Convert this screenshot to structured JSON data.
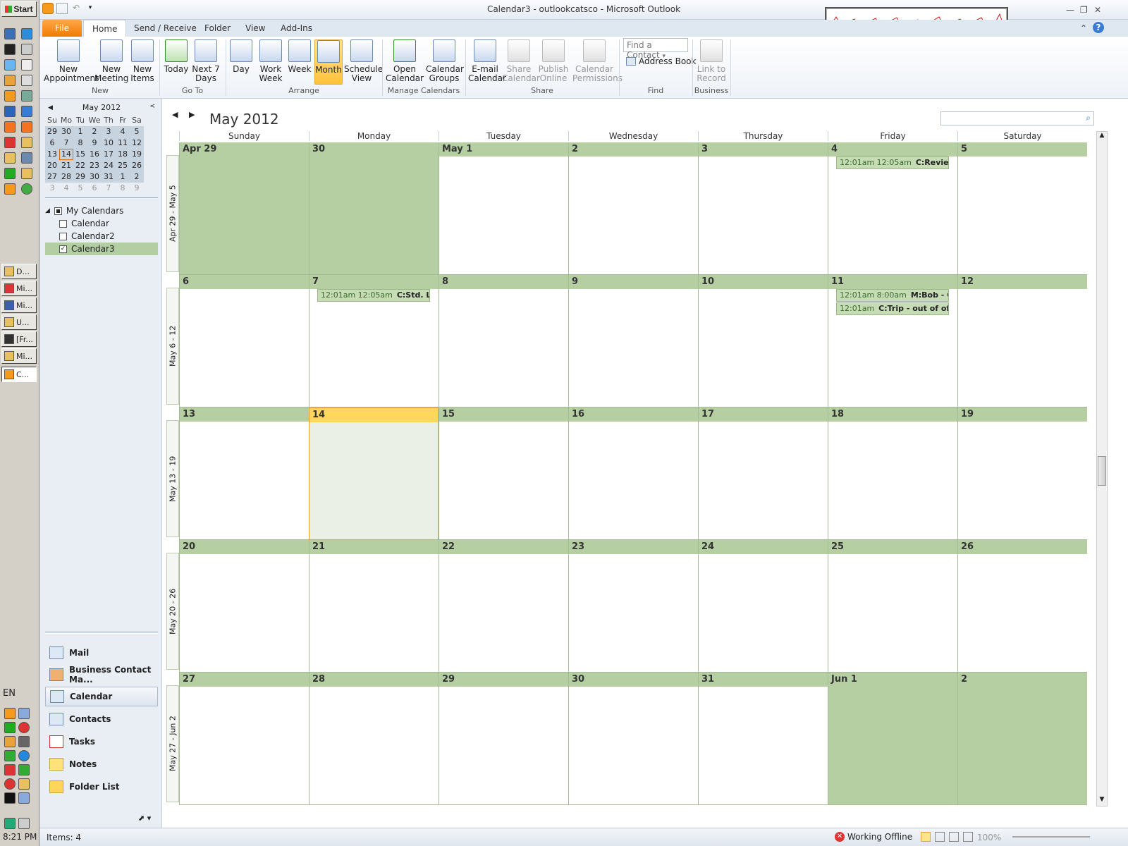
{
  "window": {
    "title": "Calendar3 - outlookcatsco  -  Microsoft Outlook"
  },
  "taskbar": {
    "start_label": "Start",
    "tasks": [
      {
        "label": "D..."
      },
      {
        "label": "Mi..."
      },
      {
        "label": "Mi..."
      },
      {
        "label": "U..."
      },
      {
        "label": "[Fr..."
      },
      {
        "label": "Mi..."
      },
      {
        "label": "C..."
      }
    ],
    "lang": "EN",
    "clock": "8:21 PM"
  },
  "tabs": [
    "File",
    "Home",
    "Send / Receive",
    "Folder",
    "View",
    "Add-Ins"
  ],
  "ribbon": {
    "new_appointment": "New\nAppointment",
    "new_meeting": "New\nMeeting",
    "new_items": "New\nItems",
    "today": "Today",
    "next7": "Next 7\nDays",
    "day": "Day",
    "work_week": "Work\nWeek",
    "week": "Week",
    "month": "Month",
    "schedule_view": "Schedule\nView",
    "open_calendar": "Open\nCalendar",
    "calendar_groups": "Calendar\nGroups",
    "email_calendar": "E-mail\nCalendar",
    "share_calendar": "Share\nCalendar",
    "publish_online": "Publish\nOnline",
    "calendar_permissions": "Calendar\nPermissions",
    "find_contact": "Find a Contact",
    "address_book": "Address Book",
    "link_to_record": "Link to\nRecord",
    "groups": {
      "new": "New",
      "goto": "Go To",
      "arrange": "Arrange",
      "manage": "Manage Calendars",
      "share": "Share",
      "find": "Find",
      "business": "Business"
    }
  },
  "minical": {
    "title": "May 2012",
    "headers": [
      "Su",
      "Mo",
      "Tu",
      "We",
      "Th",
      "Fr",
      "Sa"
    ],
    "days": [
      "29",
      "30",
      "1",
      "2",
      "3",
      "4",
      "5",
      "6",
      "7",
      "8",
      "9",
      "10",
      "11",
      "12",
      "13",
      "14",
      "15",
      "16",
      "17",
      "18",
      "19",
      "20",
      "21",
      "22",
      "23",
      "24",
      "25",
      "26",
      "27",
      "28",
      "29",
      "30",
      "31",
      "1",
      "2",
      "3",
      "4",
      "5",
      "6",
      "7",
      "8",
      "9"
    ]
  },
  "my_calendars": {
    "heading": "My Calendars",
    "items": [
      {
        "label": "Calendar",
        "checked": false
      },
      {
        "label": "Calendar2",
        "checked": false
      },
      {
        "label": "Calendar3",
        "checked": true
      }
    ]
  },
  "nav_buttons": [
    "Mail",
    "Business Contact Ma...",
    "Calendar",
    "Contacts",
    "Tasks",
    "Notes",
    "Folder List"
  ],
  "calendar": {
    "title": "May 2012",
    "days": [
      "Sunday",
      "Monday",
      "Tuesday",
      "Wednesday",
      "Thursday",
      "Friday",
      "Saturday"
    ],
    "weeks": [
      {
        "label": "Apr 29 - May 5",
        "dates": [
          "Apr 29",
          "30",
          "May 1",
          "2",
          "3",
          "4",
          "5"
        ]
      },
      {
        "label": "May 6 - 12",
        "dates": [
          "6",
          "7",
          "8",
          "9",
          "10",
          "11",
          "12"
        ]
      },
      {
        "label": "May 13 - 19",
        "dates": [
          "13",
          "14",
          "15",
          "16",
          "17",
          "18",
          "19"
        ]
      },
      {
        "label": "May 20 - 26",
        "dates": [
          "20",
          "21",
          "22",
          "23",
          "24",
          "25",
          "26"
        ]
      },
      {
        "label": "May 27 - Jun 2",
        "dates": [
          "27",
          "28",
          "29",
          "30",
          "31",
          "Jun 1",
          "2"
        ]
      }
    ],
    "appointments": [
      {
        "week": 0,
        "day": 5,
        "slot": 0,
        "time": "12:01am  12:05am",
        "subject": "C:Review INC"
      },
      {
        "week": 1,
        "day": 1,
        "slot": 0,
        "time": "12:01am  12:05am",
        "subject": "C:Std. Life of"
      },
      {
        "week": 1,
        "day": 5,
        "slot": 0,
        "time": "12:01am  8:00am",
        "subject": "M:Bob - Out"
      },
      {
        "week": 1,
        "day": 5,
        "slot": 1,
        "time": "12:01am",
        "subject": "C:Trip - out of office: I"
      }
    ]
  },
  "status": {
    "items": "Items: 4",
    "offline": "Working Offline",
    "zoom": "100%"
  }
}
